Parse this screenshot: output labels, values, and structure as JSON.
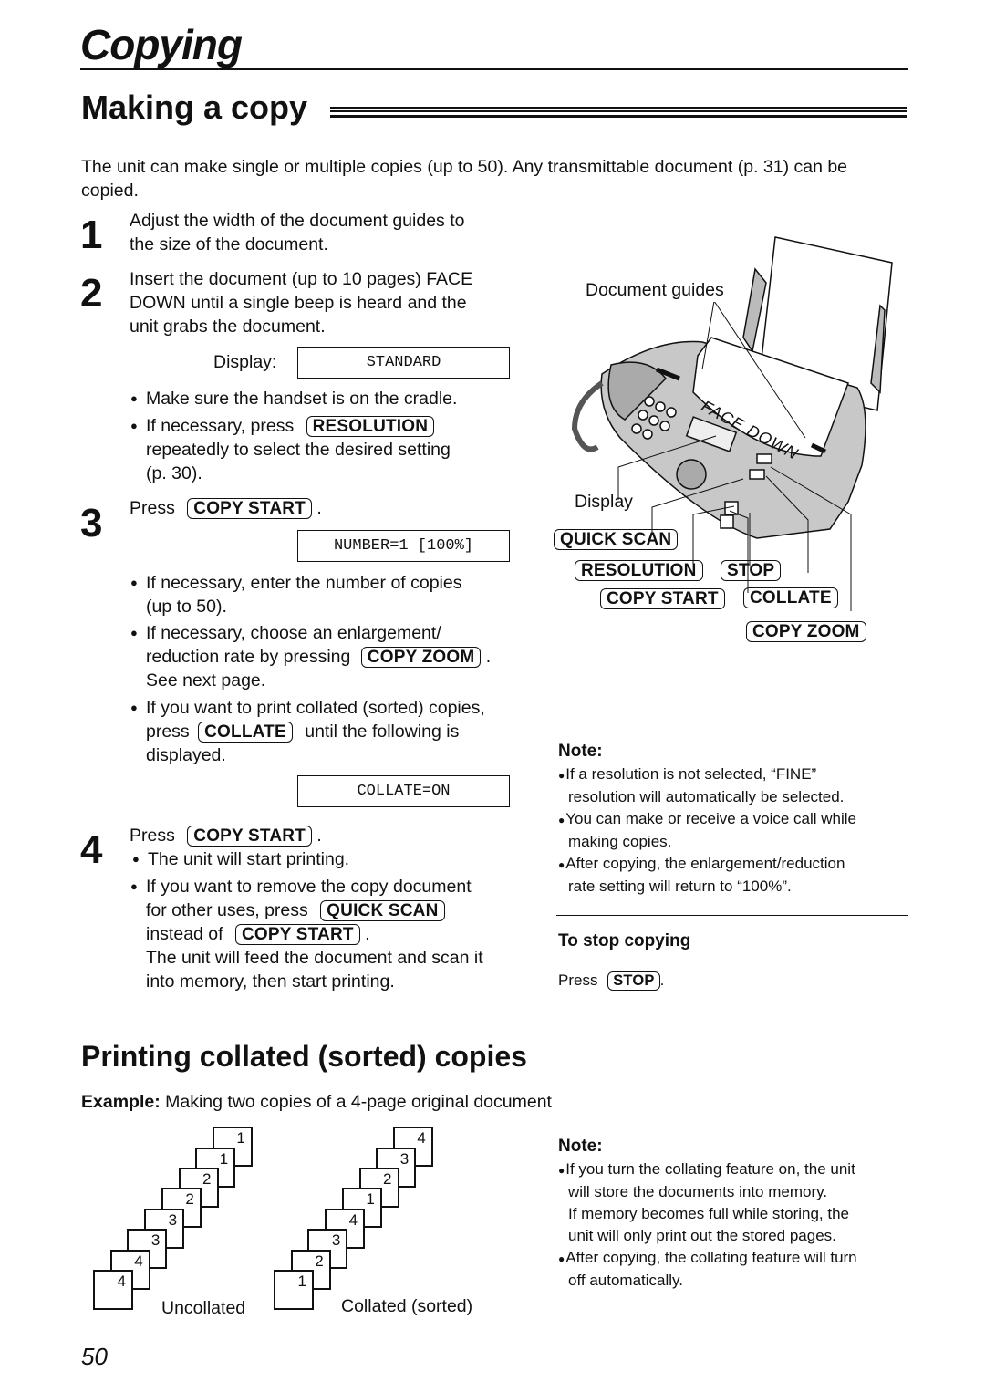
{
  "header": {
    "chapter_title": "Copying",
    "section_title": "Making a copy"
  },
  "intro": "The unit can make single or multiple copies (up to 50). Any transmittable document (p. 31) can be copied.",
  "steps": [
    {
      "number": "1",
      "lines": [
        "Adjust the width of the document guides to",
        "the size of the document."
      ]
    },
    {
      "number": "2",
      "lines": [
        "Insert the document (up to 10 pages) FACE",
        "DOWN until a single beep is heard and the",
        "unit grabs the document."
      ],
      "display_label": "Display:",
      "display_value": "STANDARD",
      "bullets": [
        "Make sure the handset is on the cradle.",
        "If necessary, press",
        "repeatedly to select the desired setting",
        "(p. 30)."
      ]
    },
    {
      "number": "3",
      "press": "Press",
      "display_value": "NUMBER=1 [100%]",
      "bullets": [
        "If necessary, enter the number of copies",
        "(up to 50).",
        "If necessary, choose an enlargement/",
        "reduction rate by pressing",
        "See next page.",
        "If you want to print collated (sorted) copies,",
        "press",
        "until the following is",
        "displayed."
      ],
      "collate_display": "COLLATE=ON"
    },
    {
      "number": "4",
      "press": "Press",
      "bullets": [
        "The unit will start printing.",
        "If you want to remove the copy document",
        "for other uses, press",
        "instead of",
        "The unit will feed the document and scan it",
        "into memory, then start printing."
      ]
    }
  ],
  "keys": {
    "resolution": "RESOLUTION",
    "copy_start": "COPY START",
    "copy_zoom": "COPY ZOOM",
    "collate": "COLLATE",
    "quick_scan": "QUICK SCAN",
    "stop": "STOP"
  },
  "illustration": {
    "document_guides": "Document guides",
    "display": "Display",
    "face_down": "FACE DOWN"
  },
  "note1": {
    "title": "Note:",
    "items": [
      "If a resolution is not selected, “FINE”",
      "resolution will automatically be selected.",
      "You can make or receive a voice call while",
      "making copies.",
      "After copying, the enlargement/reduction",
      "rate setting will return to “100%”."
    ]
  },
  "stop_copying": {
    "title": "To stop copying",
    "press": "Press"
  },
  "collated": {
    "title": "Printing collated (sorted) copies",
    "example_label": "Example:",
    "example_text": "Making two copies of a 4-page original document",
    "uncollated_label": "Uncollated",
    "collated_label": "Collated (sorted)",
    "uncollated_pages": [
      "1",
      "1",
      "2",
      "2",
      "3",
      "3",
      "4",
      "4"
    ],
    "collated_pages": [
      "4",
      "3",
      "2",
      "1",
      "4",
      "3",
      "2",
      "1"
    ]
  },
  "note2": {
    "title": "Note:",
    "items": [
      "If you turn the collating feature on, the unit",
      "will store the documents into memory.",
      "If memory becomes full while storing, the",
      "unit will only print out the stored pages.",
      "After copying, the collating feature will turn",
      "off automatically."
    ]
  },
  "page_number": "50"
}
